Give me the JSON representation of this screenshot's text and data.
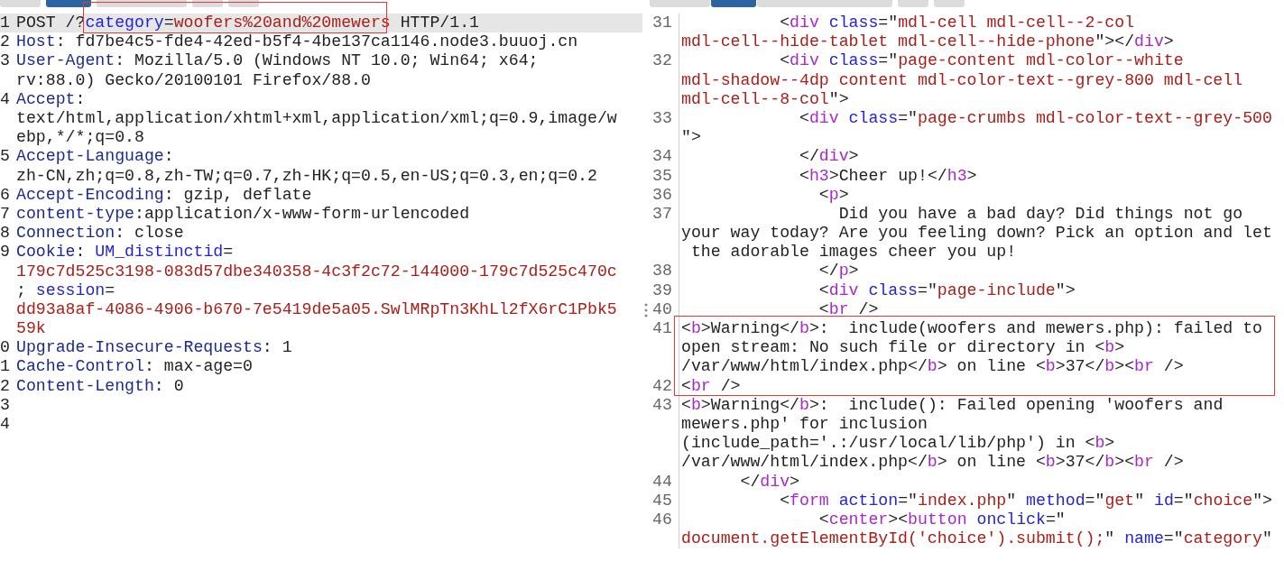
{
  "request_pane": {
    "tabs": [
      {
        "selected": false
      },
      {
        "selected": true
      },
      {
        "selected": false
      },
      {
        "selected": false
      },
      {
        "selected": false
      }
    ],
    "lines": [
      {
        "number": "1",
        "current": true,
        "rows": [
          {
            "tokens": [
              {
                "kind": "plain",
                "text": "POST /?"
              },
              {
                "framed": true,
                "tokens": [
                  {
                    "kind": "attr",
                    "text": "category"
                  },
                  {
                    "kind": "plain",
                    "text": "="
                  },
                  {
                    "kind": "value",
                    "text": "woofers%20and%20mewers"
                  }
                ]
              },
              {
                "kind": "plain",
                "text": " HTTP/1.1"
              }
            ]
          }
        ]
      },
      {
        "number": "2",
        "current": false,
        "rows": [
          {
            "tokens": [
              {
                "kind": "header",
                "text": "Host"
              },
              {
                "kind": "plain",
                "text": ": fd7be4c5-fde4-42ed-b5f4-4be137ca1146.node3.buuoj.cn"
              }
            ]
          }
        ]
      },
      {
        "number": "3",
        "current": false,
        "rows": [
          {
            "tokens": [
              {
                "kind": "header",
                "text": "User-Agent"
              },
              {
                "kind": "plain",
                "text": ": Mozilla/5.0 (Windows NT 10.0; Win64; x64;"
              }
            ]
          },
          {
            "tokens": [
              {
                "kind": "plain",
                "text": "rv:88.0) Gecko/20100101 Firefox/88.0"
              }
            ]
          }
        ]
      },
      {
        "number": "4",
        "current": false,
        "rows": [
          {
            "tokens": [
              {
                "kind": "header",
                "text": "Accept"
              },
              {
                "kind": "plain",
                "text": ":"
              }
            ]
          },
          {
            "tokens": [
              {
                "kind": "plain",
                "text": "text/html,application/xhtml+xml,application/xml;q=0.9,image/w"
              }
            ]
          },
          {
            "tokens": [
              {
                "kind": "plain",
                "text": "ebp,*/*;q=0.8"
              }
            ]
          }
        ]
      },
      {
        "number": "5",
        "current": false,
        "rows": [
          {
            "tokens": [
              {
                "kind": "header",
                "text": "Accept-Language"
              },
              {
                "kind": "plain",
                "text": ":"
              }
            ]
          },
          {
            "tokens": [
              {
                "kind": "plain",
                "text": "zh-CN,zh;q=0.8,zh-TW;q=0.7,zh-HK;q=0.5,en-US;q=0.3,en;q=0.2"
              }
            ]
          }
        ]
      },
      {
        "number": "6",
        "current": false,
        "rows": [
          {
            "tokens": [
              {
                "kind": "header",
                "text": "Accept-Encoding"
              },
              {
                "kind": "plain",
                "text": ": gzip, deflate"
              }
            ]
          }
        ]
      },
      {
        "number": "7",
        "current": false,
        "rows": [
          {
            "tokens": [
              {
                "kind": "header",
                "text": "content-type"
              },
              {
                "kind": "plain",
                "text": ":application/x-www-form-urlencoded"
              }
            ]
          }
        ]
      },
      {
        "number": "8",
        "current": false,
        "rows": [
          {
            "tokens": [
              {
                "kind": "header",
                "text": "Connection"
              },
              {
                "kind": "plain",
                "text": ": close"
              }
            ]
          }
        ]
      },
      {
        "number": "9",
        "current": false,
        "rows": [
          {
            "tokens": [
              {
                "kind": "header",
                "text": "Cookie"
              },
              {
                "kind": "plain",
                "text": ": "
              },
              {
                "kind": "attr",
                "text": "UM_distinctid"
              },
              {
                "kind": "plain",
                "text": "="
              }
            ]
          },
          {
            "tokens": [
              {
                "kind": "value",
                "text": "179c7d525c3198-083d57dbe340358-4c3f2c72-144000-179c7d525c470c"
              }
            ]
          },
          {
            "tokens": [
              {
                "kind": "plain",
                "text": "; "
              },
              {
                "kind": "attr",
                "text": "session"
              },
              {
                "kind": "plain",
                "text": "="
              }
            ]
          },
          {
            "tokens": [
              {
                "kind": "value",
                "text": "dd93a8af-4086-4906-b670-7e5419de5a05.SwlMRpTn3KhLl2fX6rC1Pbk5"
              }
            ]
          },
          {
            "tokens": [
              {
                "kind": "value",
                "text": "59k"
              }
            ]
          }
        ]
      },
      {
        "number": "0",
        "current": false,
        "rows": [
          {
            "tokens": [
              {
                "kind": "header",
                "text": "Upgrade-Insecure-Requests"
              },
              {
                "kind": "plain",
                "text": ": 1"
              }
            ]
          }
        ]
      },
      {
        "number": "1",
        "current": false,
        "rows": [
          {
            "tokens": [
              {
                "kind": "header",
                "text": "Cache-Control"
              },
              {
                "kind": "plain",
                "text": ": max-age=0"
              }
            ]
          }
        ]
      },
      {
        "number": "2",
        "current": false,
        "rows": [
          {
            "tokens": [
              {
                "kind": "header",
                "text": "Content-Length"
              },
              {
                "kind": "plain",
                "text": ": 0"
              }
            ]
          }
        ]
      },
      {
        "number": "3",
        "current": false
      },
      {
        "number": "4",
        "current": false
      }
    ]
  },
  "response_pane": {
    "tabs": [
      {
        "selected": false
      },
      {
        "selected": true
      },
      {
        "selected": false
      },
      {
        "selected": false
      },
      {
        "selected": false
      }
    ],
    "lines": [
      {
        "number": "31",
        "framed": false,
        "rows": [
          {
            "tokens": [
              {
                "kind": "plain",
                "text": "          <"
              },
              {
                "kind": "tag",
                "text": "div"
              },
              {
                "kind": "attr",
                "text": " class"
              },
              {
                "kind": "plain",
                "text": "=\""
              },
              {
                "kind": "value",
                "text": "mdl-cell mdl-cell--2-col"
              }
            ]
          },
          {
            "tokens": [
              {
                "kind": "value",
                "text": "mdl-cell--hide-tablet mdl-cell--hide-phone"
              },
              {
                "kind": "plain",
                "text": "\"></"
              },
              {
                "kind": "tag",
                "text": "div"
              },
              {
                "kind": "plain",
                "text": ">"
              }
            ]
          }
        ]
      },
      {
        "number": "32",
        "framed": false,
        "rows": [
          {
            "tokens": [
              {
                "kind": "plain",
                "text": "          <"
              },
              {
                "kind": "tag",
                "text": "div"
              },
              {
                "kind": "attr",
                "text": " class"
              },
              {
                "kind": "plain",
                "text": "=\""
              },
              {
                "kind": "value",
                "text": "page-content mdl-color--white"
              }
            ]
          },
          {
            "tokens": [
              {
                "kind": "value",
                "text": "mdl-shadow--4dp content mdl-color-text--grey-800 mdl-cell"
              }
            ]
          },
          {
            "tokens": [
              {
                "kind": "value",
                "text": "mdl-cell--8-col"
              },
              {
                "kind": "plain",
                "text": "\">"
              }
            ]
          }
        ]
      },
      {
        "number": "33",
        "framed": false,
        "rows": [
          {
            "tokens": [
              {
                "kind": "plain",
                "text": "            <"
              },
              {
                "kind": "tag",
                "text": "div"
              },
              {
                "kind": "attr",
                "text": " class"
              },
              {
                "kind": "plain",
                "text": "=\""
              },
              {
                "kind": "value",
                "text": "page-crumbs mdl-color-text--grey-500"
              }
            ]
          },
          {
            "tokens": [
              {
                "kind": "plain",
                "text": "\">"
              }
            ]
          }
        ]
      },
      {
        "number": "34",
        "framed": false,
        "rows": [
          {
            "tokens": [
              {
                "kind": "plain",
                "text": "            </"
              },
              {
                "kind": "tag",
                "text": "div"
              },
              {
                "kind": "plain",
                "text": ">"
              }
            ]
          }
        ]
      },
      {
        "number": "35",
        "framed": false,
        "rows": [
          {
            "tokens": [
              {
                "kind": "plain",
                "text": "            <"
              },
              {
                "kind": "tag",
                "text": "h3"
              },
              {
                "kind": "plain",
                "text": ">Cheer up!</"
              },
              {
                "kind": "tag",
                "text": "h3"
              },
              {
                "kind": "plain",
                "text": ">"
              }
            ]
          }
        ]
      },
      {
        "number": "36",
        "framed": false,
        "rows": [
          {
            "tokens": [
              {
                "kind": "plain",
                "text": "              <"
              },
              {
                "kind": "tag",
                "text": "p"
              },
              {
                "kind": "plain",
                "text": ">"
              }
            ]
          }
        ]
      },
      {
        "number": "37",
        "framed": false,
        "rows": [
          {
            "tokens": [
              {
                "kind": "plain",
                "text": "                Did you have a bad day? Did things not go"
              }
            ]
          },
          {
            "tokens": [
              {
                "kind": "plain",
                "text": "your way today? Are you feeling down? Pick an option and let"
              }
            ]
          },
          {
            "tokens": [
              {
                "kind": "plain",
                "text": " the adorable images cheer you up!"
              }
            ]
          }
        ]
      },
      {
        "number": "38",
        "framed": false,
        "rows": [
          {
            "tokens": [
              {
                "kind": "plain",
                "text": "              </"
              },
              {
                "kind": "tag",
                "text": "p"
              },
              {
                "kind": "plain",
                "text": ">"
              }
            ]
          }
        ]
      },
      {
        "number": "39",
        "framed": false,
        "rows": [
          {
            "tokens": [
              {
                "kind": "plain",
                "text": "              <"
              },
              {
                "kind": "tag",
                "text": "div"
              },
              {
                "kind": "attr",
                "text": " class"
              },
              {
                "kind": "plain",
                "text": "=\""
              },
              {
                "kind": "value",
                "text": "page-include"
              },
              {
                "kind": "plain",
                "text": "\">"
              }
            ]
          }
        ]
      },
      {
        "number": "40",
        "framed": false,
        "rows": [
          {
            "tokens": [
              {
                "kind": "plain",
                "text": "              <"
              },
              {
                "kind": "tag",
                "text": "br"
              },
              {
                "kind": "plain",
                "text": " />"
              }
            ]
          }
        ]
      },
      {
        "number": "41",
        "framed": true,
        "rows": [
          {
            "tokens": [
              {
                "kind": "plain",
                "text": "<"
              },
              {
                "kind": "tag",
                "text": "b"
              },
              {
                "kind": "plain",
                "text": ">Warning</"
              },
              {
                "kind": "tag",
                "text": "b"
              },
              {
                "kind": "plain",
                "text": ">:  include(woofers and mewers.php): failed to"
              }
            ]
          },
          {
            "tokens": [
              {
                "kind": "plain",
                "text": "open stream: No such file or directory in <"
              },
              {
                "kind": "tag",
                "text": "b"
              },
              {
                "kind": "plain",
                "text": ">"
              }
            ]
          },
          {
            "tokens": [
              {
                "kind": "plain",
                "text": "/var/www/html/index.php</"
              },
              {
                "kind": "tag",
                "text": "b"
              },
              {
                "kind": "plain",
                "text": "> on line <"
              },
              {
                "kind": "tag",
                "text": "b"
              },
              {
                "kind": "plain",
                "text": ">37</"
              },
              {
                "kind": "tag",
                "text": "b"
              },
              {
                "kind": "plain",
                "text": "><"
              },
              {
                "kind": "tag",
                "text": "br"
              },
              {
                "kind": "plain",
                "text": " />"
              }
            ]
          }
        ]
      },
      {
        "number": "42",
        "framed": true,
        "rows": [
          {
            "tokens": [
              {
                "kind": "plain",
                "text": "<"
              },
              {
                "kind": "tag",
                "text": "br"
              },
              {
                "kind": "plain",
                "text": " />"
              }
            ]
          }
        ]
      },
      {
        "number": "43",
        "framed": false,
        "rows": [
          {
            "tokens": [
              {
                "kind": "plain",
                "text": "<"
              },
              {
                "kind": "tag",
                "text": "b"
              },
              {
                "kind": "plain",
                "text": ">Warning</"
              },
              {
                "kind": "tag",
                "text": "b"
              },
              {
                "kind": "plain",
                "text": ">:  include(): Failed opening 'woofers and"
              }
            ]
          },
          {
            "tokens": [
              {
                "kind": "plain",
                "text": "mewers.php' for inclusion"
              }
            ]
          },
          {
            "tokens": [
              {
                "kind": "plain",
                "text": "(include_path='.:/usr/local/lib/php') in <"
              },
              {
                "kind": "tag",
                "text": "b"
              },
              {
                "kind": "plain",
                "text": ">"
              }
            ]
          },
          {
            "tokens": [
              {
                "kind": "plain",
                "text": "/var/www/html/index.php</"
              },
              {
                "kind": "tag",
                "text": "b"
              },
              {
                "kind": "plain",
                "text": "> on line <"
              },
              {
                "kind": "tag",
                "text": "b"
              },
              {
                "kind": "plain",
                "text": ">37</"
              },
              {
                "kind": "tag",
                "text": "b"
              },
              {
                "kind": "plain",
                "text": "><"
              },
              {
                "kind": "tag",
                "text": "br"
              },
              {
                "kind": "plain",
                "text": " />"
              }
            ]
          }
        ]
      },
      {
        "number": "44",
        "framed": false,
        "rows": [
          {
            "tokens": [
              {
                "kind": "plain",
                "text": "      </"
              },
              {
                "kind": "tag",
                "text": "div"
              },
              {
                "kind": "plain",
                "text": ">"
              }
            ]
          }
        ]
      },
      {
        "number": "45",
        "framed": false,
        "rows": [
          {
            "tokens": [
              {
                "kind": "plain",
                "text": "          <"
              },
              {
                "kind": "tag",
                "text": "form"
              },
              {
                "kind": "attr",
                "text": " action"
              },
              {
                "kind": "plain",
                "text": "=\""
              },
              {
                "kind": "value",
                "text": "index.php"
              },
              {
                "kind": "plain",
                "text": "\" "
              },
              {
                "kind": "attr",
                "text": "method"
              },
              {
                "kind": "plain",
                "text": "=\""
              },
              {
                "kind": "value",
                "text": "get"
              },
              {
                "kind": "plain",
                "text": "\" "
              },
              {
                "kind": "attr",
                "text": "id"
              },
              {
                "kind": "plain",
                "text": "=\""
              },
              {
                "kind": "value",
                "text": "choice"
              },
              {
                "kind": "plain",
                "text": "\">"
              }
            ]
          }
        ]
      },
      {
        "number": "46",
        "framed": false,
        "rows": [
          {
            "tokens": [
              {
                "kind": "plain",
                "text": "              <"
              },
              {
                "kind": "tag",
                "text": "center"
              },
              {
                "kind": "plain",
                "text": "><"
              },
              {
                "kind": "tag",
                "text": "button"
              },
              {
                "kind": "attr",
                "text": " onclick"
              },
              {
                "kind": "plain",
                "text": "=\""
              }
            ]
          },
          {
            "tokens": [
              {
                "kind": "value",
                "text": "document.getElementById('choice').submit();"
              },
              {
                "kind": "plain",
                "text": "\" "
              },
              {
                "kind": "attr",
                "text": "name"
              },
              {
                "kind": "plain",
                "text": "=\""
              },
              {
                "kind": "value",
                "text": "category"
              },
              {
                "kind": "plain",
                "text": "\""
              }
            ]
          }
        ]
      }
    ]
  }
}
